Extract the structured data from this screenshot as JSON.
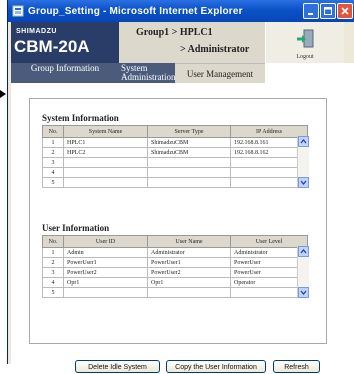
{
  "window": {
    "title": "Group_Setting - Microsoft Internet Explorer"
  },
  "header": {
    "brand": "SHIMADZU",
    "model": "CBM-20A",
    "crumb_line1": "Group1  >  HPLC1",
    "crumb_line2": ">  Administrator",
    "logout_label": "Logout"
  },
  "tabs": [
    {
      "label": "Group Information"
    },
    {
      "label": "System Administration"
    },
    {
      "label": "User Management"
    }
  ],
  "system_info": {
    "heading": "System Information",
    "columns": [
      "No.",
      "System Name",
      "Server Type",
      "IP Address"
    ],
    "rows": [
      {
        "no": "1",
        "name": "HPLC1",
        "type": "ShimadzuCBM",
        "ip": "192.168.8.161"
      },
      {
        "no": "2",
        "name": "HPLC2",
        "type": "ShimadzuCBM",
        "ip": "192.168.8.162"
      },
      {
        "no": "3",
        "name": "",
        "type": "",
        "ip": ""
      },
      {
        "no": "4",
        "name": "",
        "type": "",
        "ip": ""
      },
      {
        "no": "5",
        "name": "",
        "type": "",
        "ip": ""
      }
    ]
  },
  "user_info": {
    "heading": "User Information",
    "columns": [
      "No.",
      "User ID",
      "User Name",
      "User Level"
    ],
    "rows": [
      {
        "no": "1",
        "id": "Admin",
        "name": "Administrator",
        "level": "Administrator"
      },
      {
        "no": "2",
        "id": "PowerUser1",
        "name": "PowerUser1",
        "level": "PowerUser"
      },
      {
        "no": "3",
        "id": "PowerUser2",
        "name": "PowerUser2",
        "level": "PowerUser"
      },
      {
        "no": "4",
        "id": "Opr1",
        "name": "Opr1",
        "level": "Operator"
      },
      {
        "no": "5",
        "id": "",
        "name": "",
        "level": ""
      }
    ]
  },
  "buttons": {
    "delete_idle": "Delete Idle System",
    "copy_user": "Copy the User Information",
    "refresh": "Refresh"
  }
}
